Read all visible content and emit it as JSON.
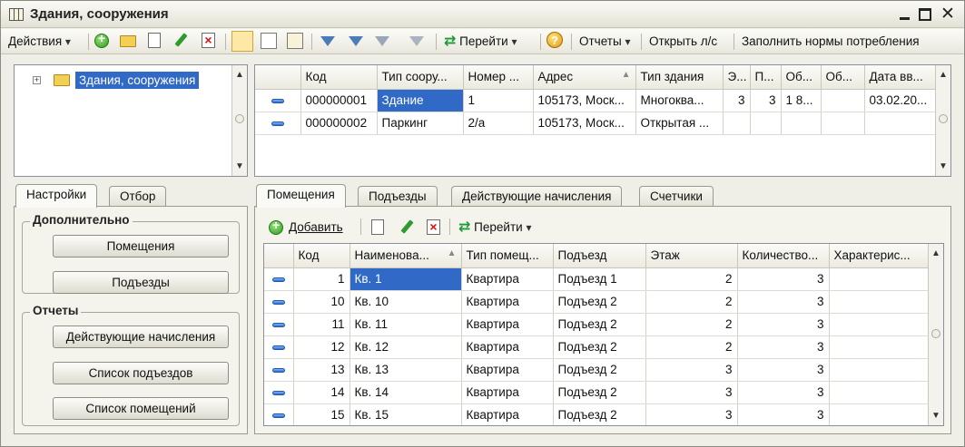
{
  "window": {
    "title": "Здания, сооружения"
  },
  "toolbar": {
    "actions": "Действия",
    "goto": "Перейти",
    "reports": "Отчеты",
    "open_account": "Открыть л/с",
    "fill_norms": "Заполнить нормы потребления"
  },
  "tree": {
    "root_label": "Здания, сооружения"
  },
  "buildings": {
    "columns": [
      "Код",
      "Тип соору...",
      "Номер ...",
      "Адрес",
      "Тип здания",
      "Э...",
      "П...",
      "Об...",
      "Об...",
      "Дата вв..."
    ],
    "rows": [
      {
        "code": "000000001",
        "type": "Здание",
        "number": "1",
        "address": "105173, Моск...",
        "building_type": "Многоква...",
        "floors": "3",
        "entrances": "3",
        "area1": "1 8...",
        "area2": "",
        "date": "03.02.20..."
      },
      {
        "code": "000000002",
        "type": "Паркинг",
        "number": "2/а",
        "address": "105173, Моск...",
        "building_type": "Открытая ...",
        "floors": "",
        "entrances": "",
        "area1": "",
        "area2": "",
        "date": ""
      }
    ]
  },
  "left_tabs": {
    "settings": "Настройки",
    "filter": "Отбор"
  },
  "groups": {
    "additional": {
      "title": "Дополнительно",
      "btn1": "Помещения",
      "btn2": "Подъезды"
    },
    "reports": {
      "title": "Отчеты",
      "btn1": "Действующие начисления",
      "btn2": "Список подъездов",
      "btn3": "Список помещений"
    }
  },
  "right_tabs": [
    "Помещения",
    "Подъезды",
    "Действующие начисления",
    "Счетчики"
  ],
  "rooms_toolbar": {
    "add": "Добавить",
    "goto": "Перейти"
  },
  "rooms": {
    "columns": [
      "Код",
      "Наименова...",
      "Тип помещ...",
      "Подъезд",
      "Этаж",
      "Количество...",
      "Характерис..."
    ],
    "rows": [
      {
        "code": "1",
        "name": "Кв. 1",
        "type": "Квартира",
        "entrance": "Подъезд 1",
        "floor": "2",
        "qty": "3",
        "char": ""
      },
      {
        "code": "10",
        "name": "Кв. 10",
        "type": "Квартира",
        "entrance": "Подъезд 2",
        "floor": "2",
        "qty": "3",
        "char": ""
      },
      {
        "code": "11",
        "name": "Кв. 11",
        "type": "Квартира",
        "entrance": "Подъезд 2",
        "floor": "2",
        "qty": "3",
        "char": ""
      },
      {
        "code": "12",
        "name": "Кв. 12",
        "type": "Квартира",
        "entrance": "Подъезд 2",
        "floor": "2",
        "qty": "3",
        "char": ""
      },
      {
        "code": "13",
        "name": "Кв. 13",
        "type": "Квартира",
        "entrance": "Подъезд 2",
        "floor": "3",
        "qty": "3",
        "char": ""
      },
      {
        "code": "14",
        "name": "Кв. 14",
        "type": "Квартира",
        "entrance": "Подъезд 2",
        "floor": "3",
        "qty": "3",
        "char": ""
      },
      {
        "code": "15",
        "name": "Кв. 15",
        "type": "Квартира",
        "entrance": "Подъезд 2",
        "floor": "3",
        "qty": "3",
        "char": ""
      }
    ]
  }
}
